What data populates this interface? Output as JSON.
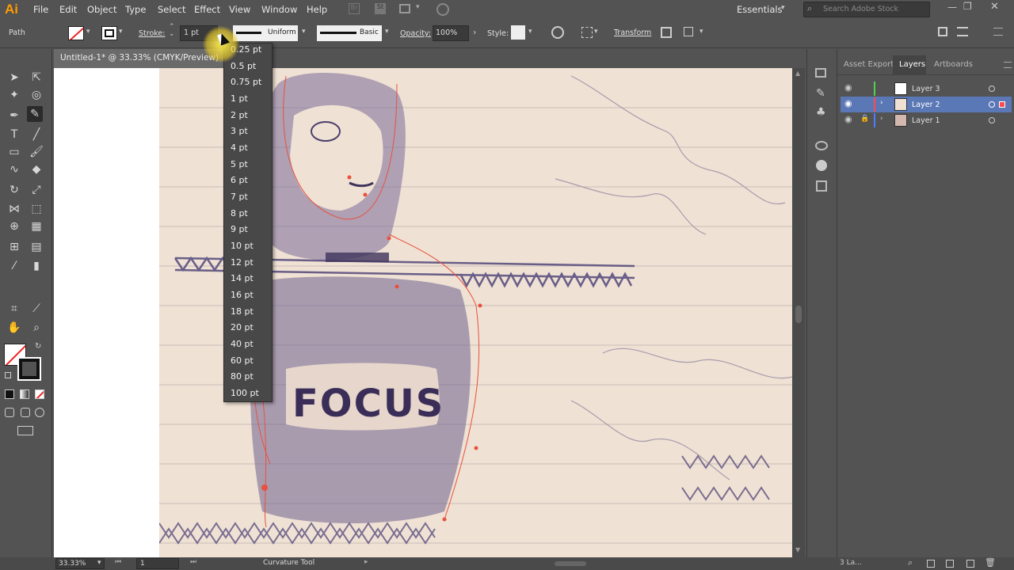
{
  "app": {
    "logo": "Ai"
  },
  "menu": [
    "File",
    "Edit",
    "Object",
    "Type",
    "Select",
    "Effect",
    "View",
    "Window",
    "Help"
  ],
  "workspace": {
    "name": "Essentials"
  },
  "search": {
    "placeholder": "Search Adobe Stock"
  },
  "control_bar": {
    "selection": "Path",
    "stroke_label": "Stroke:",
    "stroke_weight": "1 pt",
    "profile": "Uniform",
    "brush": "Basic",
    "opacity_label": "Opacity:",
    "opacity_value": "100%",
    "style_label": "Style:",
    "transform": "Transform"
  },
  "document": {
    "tab_title": "Untitled-1* @ 33.33% (CMYK/Preview)",
    "sketch_text": "FOCUS"
  },
  "stroke_dropdown": {
    "options": [
      "0.25 pt",
      "0.5 pt",
      "0.75 pt",
      "1 pt",
      "2 pt",
      "3 pt",
      "4 pt",
      "5 pt",
      "6 pt",
      "7 pt",
      "8 pt",
      "9 pt",
      "10 pt",
      "12 pt",
      "14 pt",
      "16 pt",
      "18 pt",
      "20 pt",
      "40 pt",
      "60 pt",
      "80 pt",
      "100 pt"
    ]
  },
  "panel": {
    "tabs": [
      "Asset Export",
      "Layers",
      "Artboards"
    ],
    "active_tab": "Layers",
    "layers": [
      {
        "name": "Layer 3",
        "color": "#4fd24f",
        "locked": false,
        "selected": false
      },
      {
        "name": "Layer 2",
        "color": "#ff4b4b",
        "locked": false,
        "selected": true
      },
      {
        "name": "Layer 1",
        "color": "#4f7cff",
        "locked": true,
        "selected": false
      }
    ],
    "footer_count": "3 La..."
  },
  "status": {
    "zoom": "33.33%",
    "artboard": "1",
    "tool": "Curvature Tool"
  },
  "colors": {
    "accent": "#ff9a00",
    "selection": "#5a78b6",
    "path": "#e8513f"
  }
}
